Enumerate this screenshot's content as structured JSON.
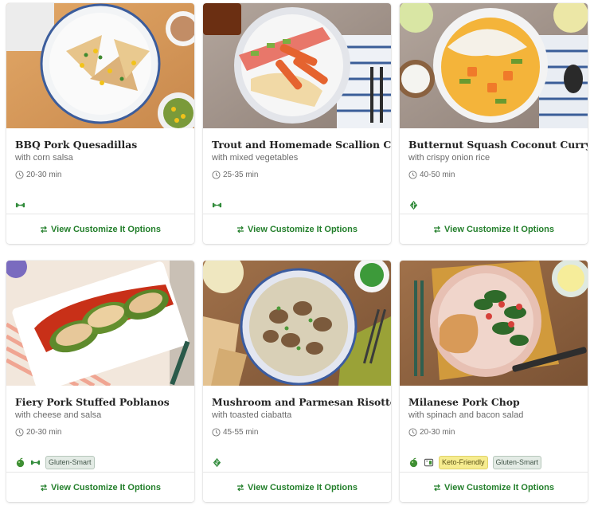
{
  "colors": {
    "accent_green": "#237f2b",
    "gluten_pill_bg": "#e3ebe5",
    "keto_pill_bg": "#f6ec8f"
  },
  "recipes": [
    {
      "title": "BBQ Pork Quesadillas",
      "subtitle": "with corn salsa",
      "time": "20-30 min",
      "tag_icons": [
        "dumbbell-icon"
      ],
      "pills": [],
      "cta": "View Customize It Options"
    },
    {
      "title": "Trout and Homemade Scallion Cake",
      "subtitle": "with mixed vegetables",
      "time": "25-35 min",
      "tag_icons": [
        "dumbbell-icon"
      ],
      "pills": [],
      "cta": "View Customize It Options"
    },
    {
      "title": "Butternut Squash Coconut Curry",
      "subtitle": "with crispy onion rice",
      "time": "40-50 min",
      "tag_icons": [
        "leaf-icon"
      ],
      "pills": [],
      "cta": "View Customize It Options"
    },
    {
      "title": "Fiery Pork Stuffed Poblanos",
      "subtitle": "with cheese and salsa",
      "time": "20-30 min",
      "tag_icons": [
        "apple-icon",
        "dumbbell-icon"
      ],
      "pills": [
        "Gluten-Smart"
      ],
      "cta": "View Customize It Options"
    },
    {
      "title": "Mushroom and Parmesan Risotto",
      "subtitle": "with toasted ciabatta",
      "time": "45-55 min",
      "tag_icons": [
        "leaf-icon"
      ],
      "pills": [],
      "cta": "View Customize It Options"
    },
    {
      "title": "Milanese Pork Chop",
      "subtitle": "with spinach and bacon salad",
      "time": "20-30 min",
      "tag_icons": [
        "apple-icon",
        "scale-icon"
      ],
      "pills": [
        "Keto-Friendly",
        "Gluten-Smart"
      ],
      "cta": "View Customize It Options"
    }
  ]
}
